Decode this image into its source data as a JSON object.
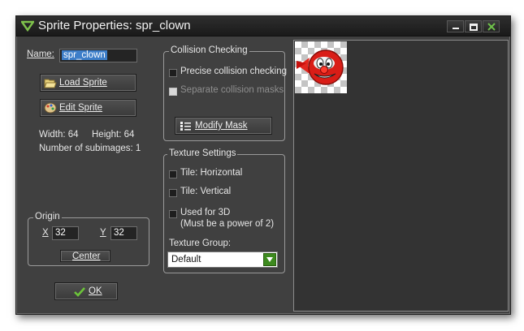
{
  "window": {
    "title": "Sprite Properties: spr_clown",
    "controls": {
      "minimize": "minimize",
      "maximize": "maximize",
      "close": "close"
    }
  },
  "name": {
    "label": "Name:",
    "value": "spr_clown"
  },
  "buttons": {
    "load_sprite": "Load Sprite",
    "edit_sprite": "Edit Sprite",
    "modify_mask": "Modify Mask",
    "center": "Center",
    "ok": "OK"
  },
  "info": {
    "width": "Width: 64",
    "height": "Height: 64",
    "subimages": "Number of subimages: 1"
  },
  "origin": {
    "legend": "Origin",
    "x_label": "X",
    "x_value": "32",
    "y_label": "Y",
    "y_value": "32"
  },
  "collision": {
    "legend": "Collision Checking",
    "precise": {
      "label": "Precise collision checking",
      "checked": false
    },
    "separate": {
      "label": "Separate collision masks",
      "checked": false,
      "disabled": true
    }
  },
  "texture": {
    "legend": "Texture Settings",
    "tile_h": {
      "label": "Tile: Horizontal",
      "checked": false
    },
    "tile_v": {
      "label": "Tile: Vertical",
      "checked": false
    },
    "used_3d": {
      "label": "Used for 3D",
      "note": "(Must be a power of 2)",
      "checked": false
    },
    "group_label": "Texture Group:",
    "group_value": "Default"
  },
  "colors": {
    "window_bg": "#404040",
    "selection": "#3d7ec9",
    "accent_green": "#3d8a1e",
    "preview_bg": "#333333"
  }
}
